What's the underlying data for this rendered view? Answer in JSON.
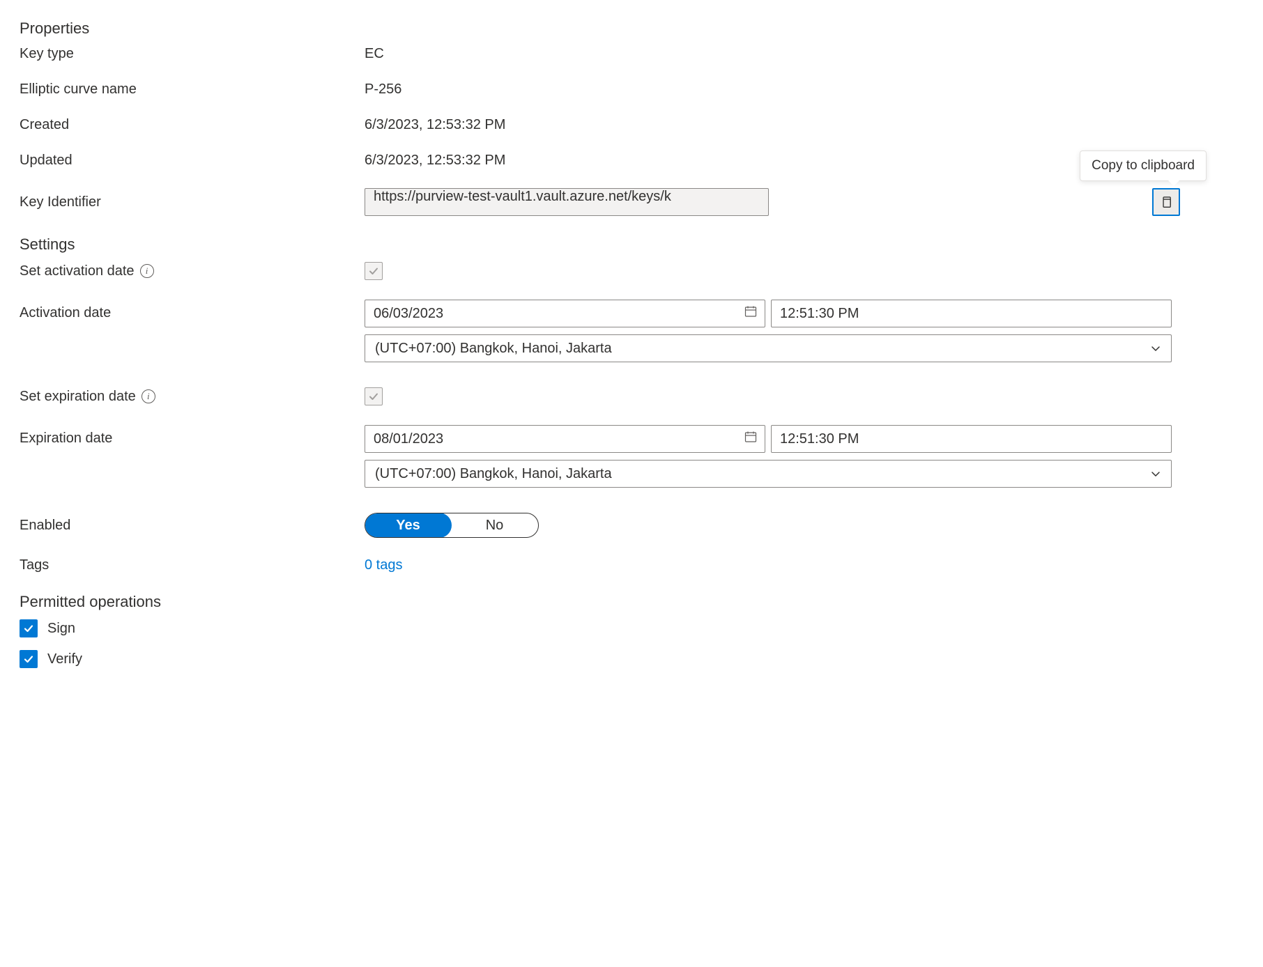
{
  "sections": {
    "properties": "Properties",
    "settings": "Settings",
    "permitted": "Permitted operations"
  },
  "labels": {
    "key_type": "Key type",
    "curve_name": "Elliptic curve name",
    "created": "Created",
    "updated": "Updated",
    "key_identifier": "Key Identifier",
    "set_activation": "Set activation date",
    "activation_date": "Activation date",
    "set_expiration": "Set expiration date",
    "expiration_date": "Expiration date",
    "enabled": "Enabled",
    "tags": "Tags"
  },
  "values": {
    "key_type": "EC",
    "curve_name": "P-256",
    "created": "6/3/2023, 12:53:32 PM",
    "updated": "6/3/2023, 12:53:32 PM",
    "key_identifier": "https://purview-test-vault1.vault.azure.net/keys/k",
    "activation_date": "06/03/2023",
    "activation_time": "12:51:30 PM",
    "activation_tz": "(UTC+07:00) Bangkok, Hanoi, Jakarta",
    "expiration_date": "08/01/2023",
    "expiration_time": "12:51:30 PM",
    "expiration_tz": "(UTC+07:00) Bangkok, Hanoi, Jakarta",
    "tags_count": "0 tags"
  },
  "toggles": {
    "yes": "Yes",
    "no": "No"
  },
  "permitted": {
    "sign": "Sign",
    "verify": "Verify"
  },
  "tooltip": {
    "copy": "Copy to clipboard"
  }
}
